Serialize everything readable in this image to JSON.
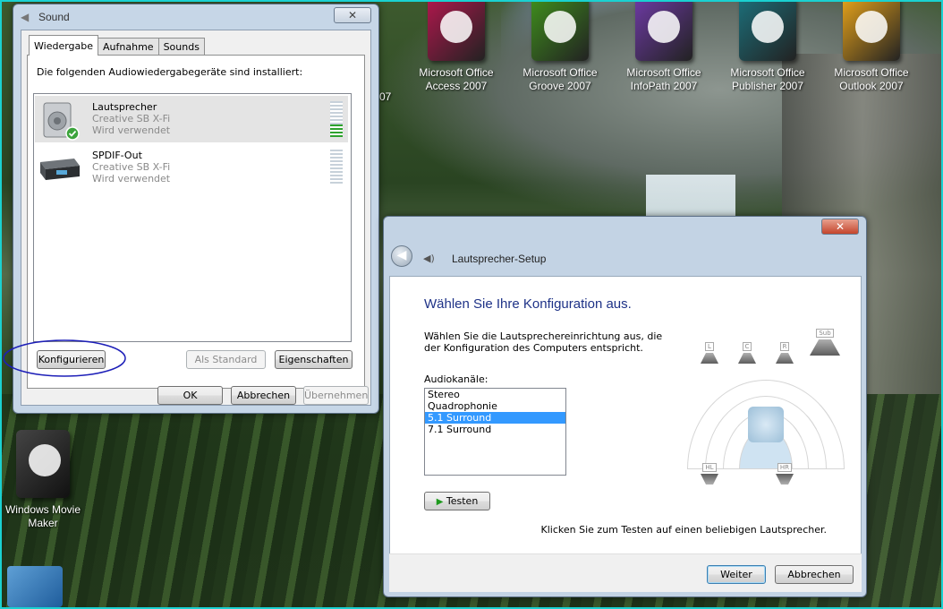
{
  "desktop": {
    "icons": [
      {
        "name": "office-access-icon",
        "label": "Microsoft Office Access 2007",
        "color": "#b1174d"
      },
      {
        "name": "office-groove-icon",
        "label": "Microsoft Office Groove 2007",
        "color": "#3f8f1c"
      },
      {
        "name": "office-infopath-icon",
        "label": "Microsoft Office InfoPath 2007",
        "color": "#6e3aa5"
      },
      {
        "name": "office-publisher-icon",
        "label": "Microsoft Office Publisher 2007",
        "color": "#1c6f7a"
      },
      {
        "name": "office-outlook-icon",
        "label": "Microsoft Office Outlook 2007",
        "color": "#e7a31a"
      }
    ],
    "partial_label": "07",
    "movie_maker_label": "Windows Movie Maker"
  },
  "sound": {
    "title": "Sound",
    "tabs": [
      "Wiedergabe",
      "Aufnahme",
      "Sounds"
    ],
    "intro": "Die folgenden Audiowiedergabegeräte sind installiert:",
    "devices": [
      {
        "name": "Lautsprecher",
        "driver": "Creative SB X-Fi",
        "status": "Wird verwendet",
        "level": 0.35
      },
      {
        "name": "SPDIF-Out",
        "driver": "Creative SB X-Fi",
        "status": "Wird verwendet",
        "level": 0.0
      }
    ],
    "buttons": {
      "configure": "Konfigurieren",
      "default": "Als Standard",
      "properties": "Eigenschaften",
      "ok": "OK",
      "cancel": "Abbrechen",
      "apply": "Übernehmen"
    }
  },
  "wizard": {
    "title": "Lautsprecher-Setup",
    "heading": "Wählen Sie Ihre Konfiguration aus.",
    "description": "Wählen Sie die Lautsprechereinrichtung aus, die der Konfiguration des Computers entspricht.",
    "channels_label": "Audiokanäle:",
    "channels": [
      "Stereo",
      "Quadrophonie",
      "5.1 Surround",
      "7.1 Surround"
    ],
    "selected_channel": "5.1 Surround",
    "test_button": "Testen",
    "hint": "Klicken Sie zum Testen auf einen beliebigen Lautsprecher.",
    "next_button": "Weiter",
    "cancel_button": "Abbrechen",
    "speaker_labels": {
      "left": "L",
      "center": "C",
      "right": "R",
      "sub": "Sub",
      "rear_left": "HL",
      "rear_right": "HR"
    }
  }
}
